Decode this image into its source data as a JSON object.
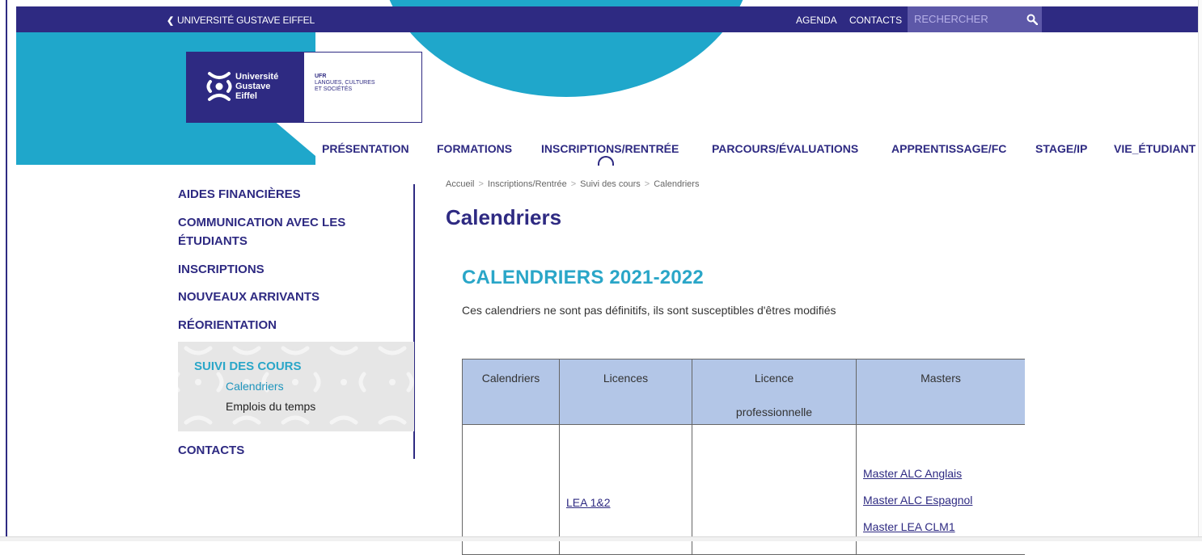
{
  "topbar": {
    "back_label": "UNIVERSITÉ GUSTAVE EIFFEL",
    "agenda": "AGENDA",
    "contacts": "CONTACTS",
    "search_placeholder": "RECHERCHER"
  },
  "logo": {
    "line1": "Université",
    "line2": "Gustave",
    "line3": "Eiffel",
    "ufr": "UFR",
    "ufr_line2": "LANGUES, CULTURES",
    "ufr_line3": "ET SOCIÉTÉS"
  },
  "nav": {
    "items": [
      "PRÉSENTATION",
      "FORMATIONS",
      "INSCRIPTIONS/RENTRÉE",
      "PARCOURS/ÉVALUATIONS",
      "APPRENTISSAGE/FC",
      "STAGE/IP",
      "VIE_ÉTUDIANT"
    ]
  },
  "sidebar": {
    "items": [
      "AIDES FINANCIÈRES",
      "COMMUNICATION AVEC LES",
      "ÉTUDIANTS",
      "INSCRIPTIONS",
      "NOUVEAUX ARRIVANTS",
      "RÉORIENTATION"
    ],
    "active_title": "SUIVI DES COURS",
    "active_sub1": "Calendriers",
    "active_sub2": "Emplois du temps",
    "last_item": "CONTACTS"
  },
  "breadcrumb": [
    "Accueil",
    "Inscriptions/Rentrée",
    "Suivi des cours",
    "Calendriers"
  ],
  "breadcrumb_sep": ">",
  "page_title": "Calendriers",
  "section_title": "CALENDRIERS 2021-2022",
  "intro": "Ces calendriers ne sont pas définitifs, ils sont susceptibles d'êtres modifiés",
  "table": {
    "headers": [
      "Calendriers",
      "Licences",
      "Licence",
      "professionnelle",
      "Masters"
    ],
    "licences_link": "LEA 1&2",
    "masters_links": [
      "Master ALC Anglais",
      "Master ALC Espagnol",
      "Master LEA CLM1"
    ]
  },
  "colors": {
    "brand_navy": "#2e2a82",
    "brand_cyan": "#1fa7cb",
    "table_header": "#b3c6e7"
  }
}
